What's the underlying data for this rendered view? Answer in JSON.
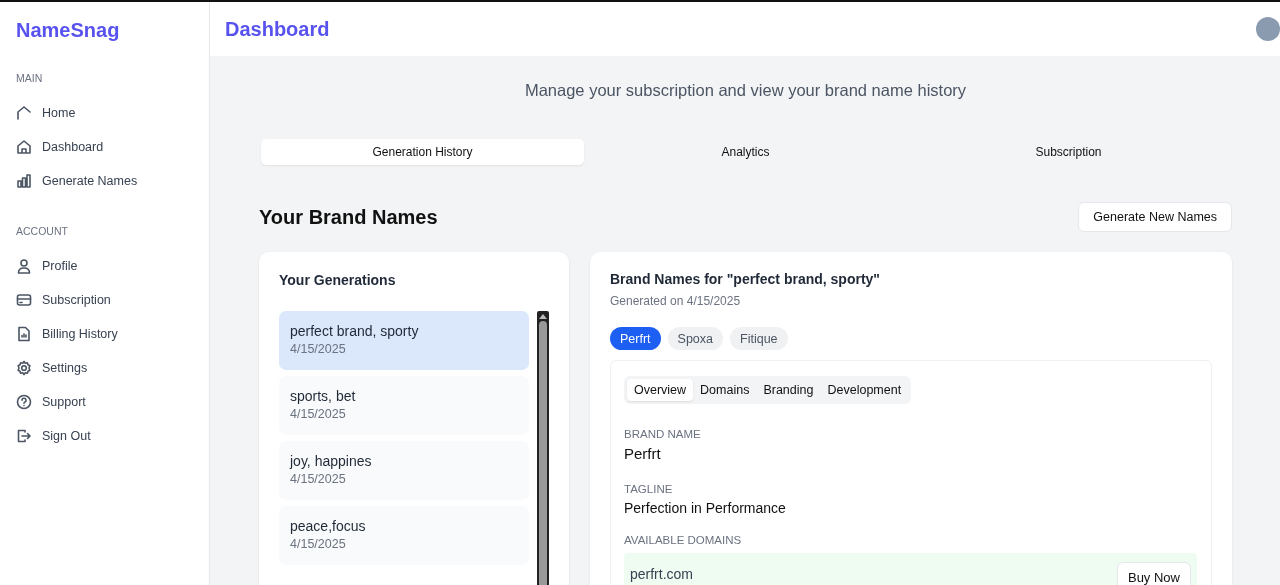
{
  "sidebar": {
    "logo": "NameSnag",
    "sections": [
      {
        "heading": "MAIN",
        "items": [
          {
            "label": "Home"
          },
          {
            "label": "Dashboard"
          },
          {
            "label": "Generate Names"
          }
        ]
      },
      {
        "heading": "ACCOUNT",
        "items": [
          {
            "label": "Profile"
          },
          {
            "label": "Subscription"
          },
          {
            "label": "Billing History"
          },
          {
            "label": "Settings"
          },
          {
            "label": "Support"
          },
          {
            "label": "Sign Out"
          }
        ]
      }
    ]
  },
  "header": {
    "title": "Dashboard"
  },
  "page": {
    "subtitle": "Manage your subscription and view your brand name history"
  },
  "tabs": [
    {
      "label": "Generation History",
      "selected": true
    },
    {
      "label": "Analytics",
      "selected": false
    },
    {
      "label": "Subscription",
      "selected": false
    }
  ],
  "section": {
    "title": "Your Brand Names",
    "button": "Generate New Names"
  },
  "generations": {
    "title": "Your Generations",
    "items": [
      {
        "query": "perfect brand, sporty",
        "date": "4/15/2025",
        "selected": true
      },
      {
        "query": "sports, bet",
        "date": "4/15/2025",
        "selected": false
      },
      {
        "query": "joy, happines",
        "date": "4/15/2025",
        "selected": false
      },
      {
        "query": "peace,focus",
        "date": "4/15/2025",
        "selected": false
      }
    ]
  },
  "detail": {
    "title": "Brand Names for \"perfect brand, sporty\"",
    "generated": "Generated on 4/15/2025",
    "names": [
      {
        "label": "Perfrt",
        "selected": true
      },
      {
        "label": "Spoxa",
        "selected": false
      },
      {
        "label": "Fitique",
        "selected": false
      }
    ],
    "tabs": [
      {
        "label": "Overview",
        "selected": true
      },
      {
        "label": "Domains",
        "selected": false
      },
      {
        "label": "Branding",
        "selected": false
      },
      {
        "label": "Development",
        "selected": false
      }
    ],
    "brand_name": {
      "label": "BRAND NAME",
      "value": "Perfrt"
    },
    "tagline": {
      "label": "TAGLINE",
      "value": "Perfection in Performance"
    },
    "domains": {
      "label": "AVAILABLE DOMAINS",
      "items": [
        {
          "domain": "perfrt.com",
          "button": "Buy Now"
        }
      ]
    }
  }
}
